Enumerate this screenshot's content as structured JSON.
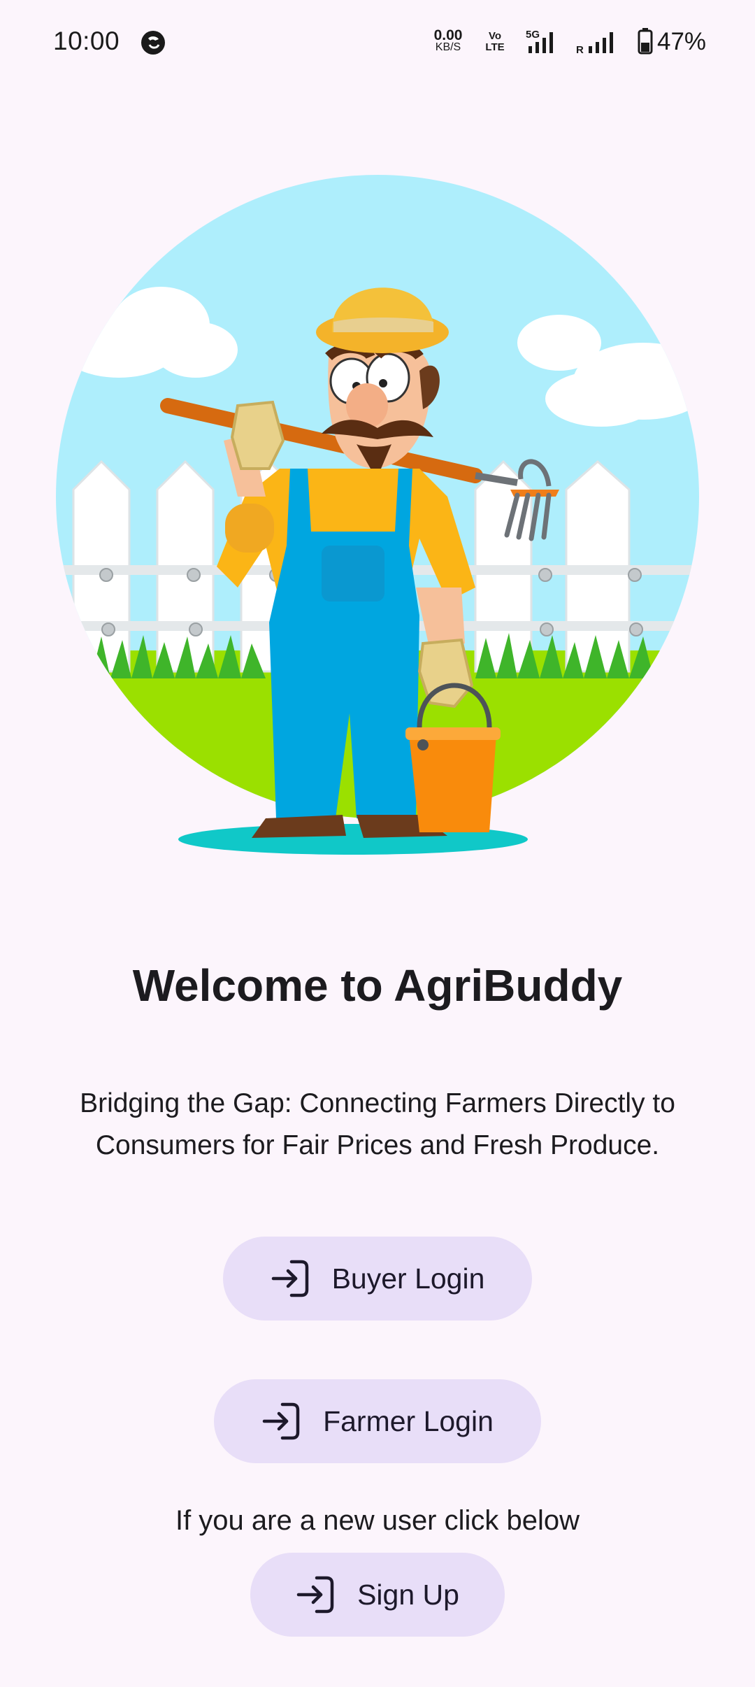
{
  "status_bar": {
    "time": "10:00",
    "net_speed_value": "0.00",
    "net_speed_unit": "KB/S",
    "volte_top": "Vo",
    "volte_bottom": "LTE",
    "network": "5G",
    "roaming": "R",
    "battery_level": 0.47,
    "battery": "47%"
  },
  "hero": {
    "icon": "farmer-illustration"
  },
  "welcome": {
    "title": "Welcome to AgriBuddy",
    "subtitle": "Bridging the Gap: Connecting Farmers Directly to Consumers for Fair Prices and Fresh Produce."
  },
  "actions": {
    "buyer_login": "Buyer Login",
    "farmer_login": "Farmer Login",
    "new_user_hint": "If you are a new user click below",
    "sign_up": "Sign Up",
    "button_icon": "login-icon"
  },
  "colors": {
    "background": "#fcf5fc",
    "button_background": "#e8def8",
    "sky": "#aeeefc",
    "grass": "#9be000"
  }
}
